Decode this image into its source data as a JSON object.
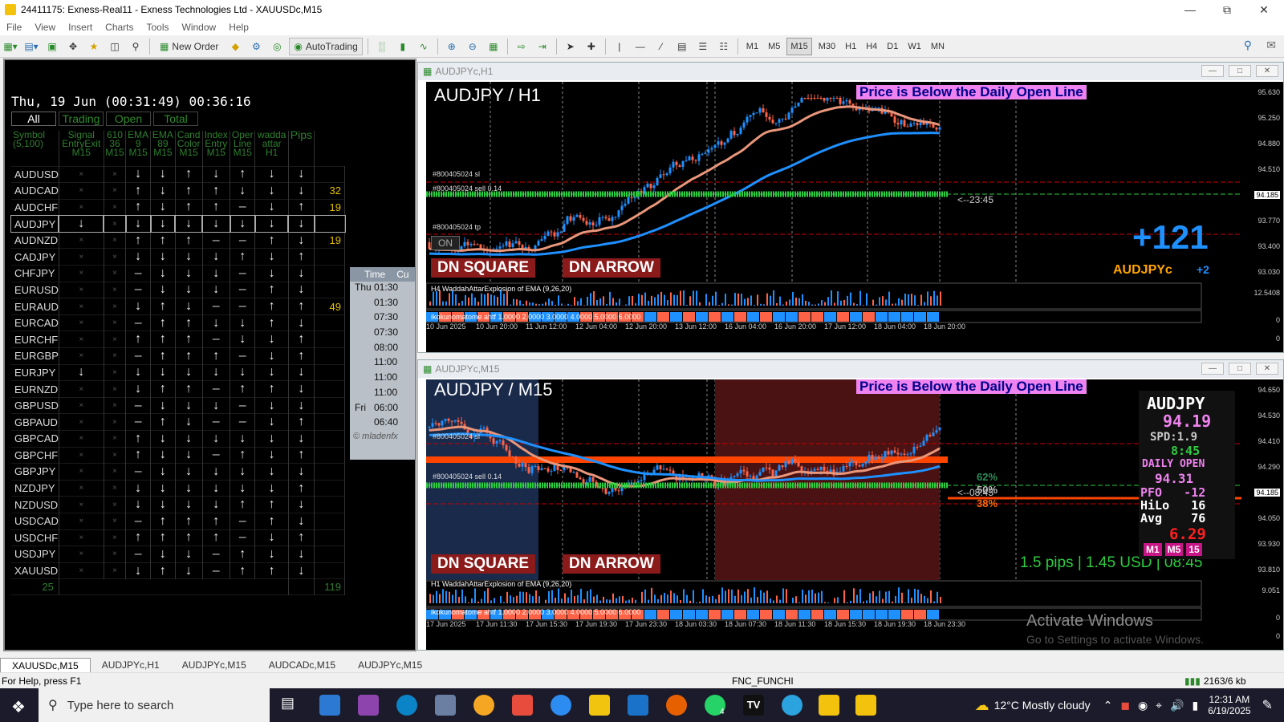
{
  "window": {
    "title": "24411175: Exness-Real11 - Exness Technologies Ltd - XAUUSDc,M15"
  },
  "menu": [
    "File",
    "View",
    "Insert",
    "Charts",
    "Tools",
    "Window",
    "Help"
  ],
  "toolbar": {
    "new_order": "New Order",
    "autotrading": "AutoTrading",
    "timeframes": [
      "M1",
      "M5",
      "M15",
      "M30",
      "H1",
      "H4",
      "D1",
      "W1",
      "MN"
    ],
    "active_tf": "M15"
  },
  "dashboard": {
    "clock": "Thu, 19 Jun (00:31:49) 00:36:16",
    "tabs": [
      "All",
      "Trading",
      "Open",
      "Total"
    ],
    "headers": [
      {
        "top": "Symbol",
        "bottom": "(5,100)"
      },
      {
        "top": "Signal",
        "mid": "EntryExit",
        "bottom": "M15"
      },
      {
        "top": "610",
        "mid": "36",
        "bottom": "M15"
      },
      {
        "top": "EMA",
        "mid": "9",
        "bottom": "M15"
      },
      {
        "top": "EMA",
        "mid": "89",
        "bottom": "M15"
      },
      {
        "top": "Cand",
        "mid": "Color",
        "bottom": "M15"
      },
      {
        "top": "Index",
        "mid": "Entry",
        "bottom": "M15"
      },
      {
        "top": "Oper",
        "mid": "Line",
        "bottom": "M15"
      },
      {
        "top": "wadda",
        "mid": "attar",
        "bottom": "H1"
      },
      {
        "top": "Pips",
        "mid": "",
        "bottom": ""
      }
    ],
    "rows": [
      {
        "sym": "AUDUSD",
        "c": [
          "x",
          "x",
          "dn",
          "dn",
          "upw",
          "dn",
          "up",
          "dn",
          "dn"
        ],
        "pips": ""
      },
      {
        "sym": "AUDCAD",
        "c": [
          "x",
          "x",
          "up",
          "dn",
          "up",
          "up",
          "dn",
          "dn",
          "dnw"
        ],
        "pips": "32"
      },
      {
        "sym": "AUDCHF",
        "c": [
          "x",
          "x",
          "up",
          "dn",
          "up",
          "up",
          "-",
          "dn",
          "upw"
        ],
        "pips": "19"
      },
      {
        "sym": "AUDJPY",
        "c": [
          "dn",
          "x",
          "dn",
          "dn",
          "dn",
          "dn",
          "dn",
          "dn",
          "dnw"
        ],
        "pips": ""
      },
      {
        "sym": "AUDNZD",
        "c": [
          "x",
          "x",
          "up",
          "upw",
          "up",
          "-",
          "-",
          "upw",
          "dnw"
        ],
        "pips": "19"
      },
      {
        "sym": "CADJPY",
        "c": [
          "x",
          "x",
          "dn",
          "dn",
          "dn",
          "dn",
          "upw",
          "dn",
          "up"
        ],
        "pips": ""
      },
      {
        "sym": "CHFJPY",
        "c": [
          "x",
          "x",
          "-",
          "dn",
          "dn",
          "dn",
          "-",
          "dn",
          "dnw"
        ],
        "pips": ""
      },
      {
        "sym": "EURUSD",
        "c": [
          "x",
          "x",
          "-",
          "dn",
          "dn",
          "dn",
          "-",
          "up",
          "dn"
        ],
        "pips": ""
      },
      {
        "sym": "EURAUD",
        "c": [
          "x",
          "x",
          "dn",
          "up",
          "dn",
          "-",
          "-",
          "up",
          "upw"
        ],
        "pips": "49"
      },
      {
        "sym": "EURCAD",
        "c": [
          "x",
          "x",
          "-",
          "up",
          "up",
          "dn",
          "dn",
          "up",
          "dn"
        ],
        "pips": ""
      },
      {
        "sym": "EURCHF",
        "c": [
          "x",
          "x",
          "up",
          "up",
          "up",
          "-",
          "dn",
          "dn",
          "upw"
        ],
        "pips": ""
      },
      {
        "sym": "EURGBP",
        "c": [
          "x",
          "x",
          "-",
          "up",
          "up",
          "up",
          "-",
          "dn",
          "upw"
        ],
        "pips": ""
      },
      {
        "sym": "EURJPY",
        "c": [
          "dn",
          "x",
          "dn",
          "dn",
          "dn",
          "dn",
          "dn",
          "dn",
          "dnw"
        ],
        "pips": ""
      },
      {
        "sym": "EURNZD",
        "c": [
          "x",
          "x",
          "dn",
          "up",
          "up",
          "-",
          "up",
          "up",
          "dn"
        ],
        "pips": ""
      },
      {
        "sym": "GBPUSD",
        "c": [
          "x",
          "x",
          "-",
          "dn",
          "dn",
          "dn",
          "-",
          "dn",
          "dn"
        ],
        "pips": ""
      },
      {
        "sym": "GBPAUD",
        "c": [
          "x",
          "x",
          "-",
          "up",
          "dn",
          "-",
          "-",
          "dn",
          "upw"
        ],
        "pips": ""
      },
      {
        "sym": "GBPCAD",
        "c": [
          "x",
          "x",
          "up",
          "dn",
          "dn",
          "dn",
          "dn",
          "dn",
          "dn"
        ],
        "pips": ""
      },
      {
        "sym": "GBPCHF",
        "c": [
          "x",
          "x",
          "up",
          "dn",
          "dn",
          "-",
          "up",
          "dn",
          "upw"
        ],
        "pips": ""
      },
      {
        "sym": "GBPJPY",
        "c": [
          "x",
          "x",
          "-",
          "dn",
          "dn",
          "dn",
          "dn",
          "dn",
          "dnw"
        ],
        "pips": ""
      },
      {
        "sym": "NZDJPY",
        "c": [
          "x",
          "x",
          "dn",
          "dn",
          "dn",
          "dn",
          "dn",
          "dn",
          "up"
        ],
        "pips": ""
      },
      {
        "sym": "NZDUSD",
        "c": [
          "x",
          "x",
          "dn",
          "dn",
          "dn",
          "dn",
          "up",
          "up",
          "dn"
        ],
        "pips": ""
      },
      {
        "sym": "USDCAD",
        "c": [
          "x",
          "x",
          "-",
          "up",
          "up",
          "up",
          "-",
          "up",
          "dn"
        ],
        "pips": ""
      },
      {
        "sym": "USDCHF",
        "c": [
          "x",
          "x",
          "up",
          "up",
          "up",
          "up",
          "-",
          "dn",
          "up"
        ],
        "pips": ""
      },
      {
        "sym": "USDJPY",
        "c": [
          "x",
          "x",
          "-",
          "dn",
          "dn",
          "-",
          "up",
          "dn",
          "dnw"
        ],
        "pips": ""
      },
      {
        "sym": "XAUUSD",
        "c": [
          "x",
          "x",
          "dn",
          "up",
          "dn",
          "-",
          "up",
          "up",
          "dn"
        ],
        "pips": ""
      }
    ],
    "footer": {
      "count": "25",
      "total": "119"
    },
    "news": {
      "header": "Time",
      "header2": "Cu",
      "rows": [
        {
          "day": "Thu",
          "time": "01:30"
        },
        {
          "day": "",
          "time": "01:30"
        },
        {
          "day": "",
          "time": "07:30"
        },
        {
          "day": "",
          "time": "07:30"
        },
        {
          "day": "",
          "time": "08:00"
        },
        {
          "day": "",
          "time": "11:00"
        },
        {
          "day": "",
          "time": "11:00"
        },
        {
          "day": "",
          "time": "11:00"
        },
        {
          "day": "Fri",
          "time": "06:00"
        },
        {
          "day": "",
          "time": "06:40"
        }
      ],
      "footer": "© mladenfx"
    }
  },
  "chart_h1": {
    "window_title": "AUDJPYc,H1",
    "pair": "AUDJPY / H1",
    "notice": "Price is Below the Daily Open Line",
    "badge1": "DN SQUARE",
    "badge2": "DN ARROW",
    "big": "+121",
    "sym": "AUDJPYc",
    "sym2": "+2",
    "countdown": "<--23:45",
    "on_btn": "ON",
    "order_labels": [
      "#800405024 sl",
      "#800405024 sell 0.14",
      "#800405024 tp"
    ],
    "prices": [
      "95.630",
      "95.250",
      "94.880",
      "94.510",
      "94.185",
      "93.770",
      "93.400",
      "93.030",
      "12.5408",
      "0",
      "0"
    ],
    "times": [
      "10 Jun 2025",
      "10 Jun 20:00",
      "11 Jun 12:00",
      "12 Jun 04:00",
      "12 Jun 20:00",
      "13 Jun 12:00",
      "16 Jun 04:00",
      "16 Jun 20:00",
      "17 Jun 12:00",
      "18 Jun 04:00",
      "18 Jun 20:00"
    ],
    "ind1": "H4 WaddahAttarExplosion of EMA (9,26,20)",
    "ind2": "ikokunomatome ahtf 1.0000 2.0000 3.0000 4.0000 5.0000 6.0000"
  },
  "chart_m15": {
    "window_title": "AUDJPYc,M15",
    "pair": "AUDJPY / M15",
    "notice": "Price is Below the Daily Open Line",
    "badge1": "DN SQUARE",
    "badge2": "DN ARROW",
    "countdown": "<--08:45",
    "fib": [
      "62%",
      "50%",
      "38%"
    ],
    "order_labels": [
      "#800405024 sl",
      "#800405024 sell 0.14"
    ],
    "prices": [
      "94.650",
      "94.530",
      "94.410",
      "94.290",
      "94.185",
      "94.050",
      "93.930",
      "93.810",
      "9.051",
      "0",
      "0"
    ],
    "times": [
      "17 Jun 2025",
      "17 Jun 11:30",
      "17 Jun 15:30",
      "17 Jun 19:30",
      "17 Jun 23:30",
      "18 Jun 03:30",
      "18 Jun 07:30",
      "18 Jun 11:30",
      "18 Jun 15:30",
      "18 Jun 19:30",
      "18 Jun 23:30"
    ],
    "ind1": "H1 WaddahAttarExplosion of EMA (9,26,20)",
    "ind2": "ikokunomatome ahtf 1.0000 2.0000 3.0000 4.0000 5.0000 6.0000",
    "panel": {
      "sym": "AUDJPY",
      "price": "94.19",
      "spd": "SPD:1.9",
      "timer": "8:45",
      "daily_open_label": "DAILY OPEN",
      "daily_open": "94.31",
      "pfo": "PFO   -12",
      "hilo": "HiLo   16",
      "avg": "Avg    76",
      "value": "6.29",
      "tfs": [
        "M1",
        "M5",
        "15"
      ]
    },
    "pips_text": "1.5 pips | 1.45 USD | 08:45"
  },
  "tabs": [
    "XAUUSDc,M15",
    "AUDJPYc,H1",
    "AUDJPYc,M15",
    "AUDCADc,M15",
    "AUDJPYc,M15"
  ],
  "status": {
    "help": "For Help, press F1",
    "profile": "FNC_FUNCHI",
    "traffic": "2163/6 kb"
  },
  "taskbar": {
    "search": "Type here to search",
    "weather": "12°C  Mostly cloudy",
    "time": "12:31 AM",
    "date": "6/19/2025",
    "notif": "4"
  },
  "watermark": {
    "line1": "Activate Windows",
    "line2": "Go to Settings to activate Windows."
  }
}
